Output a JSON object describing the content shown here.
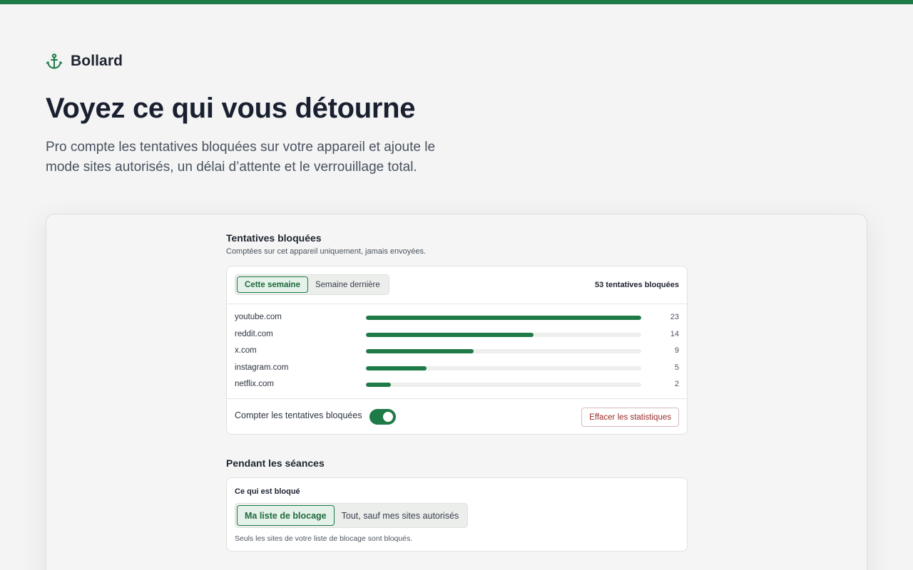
{
  "brand": {
    "name": "Bollard",
    "icon": "anchor-icon"
  },
  "hero": {
    "title": "Voyez ce qui vous détourne",
    "subtitle_line1": "Pro compte les tentatives bloquées sur votre appareil et ajoute le",
    "subtitle_line2": "mode sites autorisés, un délai d’attente et le verrouillage total."
  },
  "blocked": {
    "title": "Tentatives bloquées",
    "subtitle": "Comptées sur cet appareil uniquement, jamais envoyées.",
    "period_tabs": [
      {
        "label": "Cette semaine",
        "active": true
      },
      {
        "label": "Semaine dernière",
        "active": false
      }
    ],
    "total_label": "53 tentatives bloquées",
    "sites": [
      {
        "domain": "youtube.com",
        "count": 23,
        "share": 1.0
      },
      {
        "domain": "reddit.com",
        "count": 14,
        "share": 0.61
      },
      {
        "domain": "x.com",
        "count": 9,
        "share": 0.39
      },
      {
        "domain": "instagram.com",
        "count": 5,
        "share": 0.22
      },
      {
        "domain": "netflix.com",
        "count": 2,
        "share": 0.09
      }
    ],
    "toggle_label": "Compter les tentatives bloquées",
    "toggle_on": true,
    "clear_button": "Effacer les statistiques"
  },
  "sessions": {
    "title": "Pendant les séances",
    "field_label": "Ce qui est bloqué",
    "modes": [
      {
        "label": "Ma liste de blocage",
        "active": true
      },
      {
        "label": "Tout, sauf mes sites autorisés",
        "active": false
      }
    ],
    "help": "Seuls les sites de votre liste de blocage sont bloqués."
  },
  "colors": {
    "accent": "#1e7a46",
    "danger": "#9a2a2a",
    "background": "#f3f4f3"
  }
}
